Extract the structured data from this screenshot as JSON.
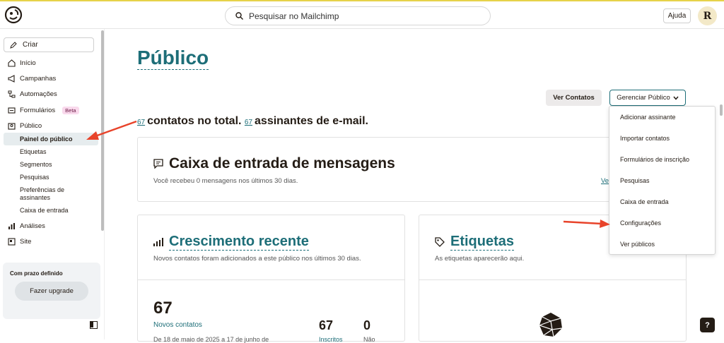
{
  "header": {
    "search_placeholder": "Pesquisar no Mailchimp",
    "help_label": "Ajuda",
    "avatar_initial": "R"
  },
  "sidebar": {
    "create_label": "Criar",
    "items": [
      {
        "label": "Início",
        "icon": "home-icon"
      },
      {
        "label": "Campanhas",
        "icon": "megaphone-icon"
      },
      {
        "label": "Automações",
        "icon": "automation-icon"
      },
      {
        "label": "Formulários",
        "icon": "form-icon",
        "badge": "Beta"
      },
      {
        "label": "Público",
        "icon": "audience-icon"
      }
    ],
    "sub_items": [
      {
        "label": "Painel do público",
        "active": true
      },
      {
        "label": "Etiquetas"
      },
      {
        "label": "Segmentos"
      },
      {
        "label": "Pesquisas"
      },
      {
        "label": "Preferências de assinantes"
      },
      {
        "label": "Caixa de entrada"
      }
    ],
    "bottom_items": [
      {
        "label": "Análises",
        "icon": "chart-icon"
      },
      {
        "label": "Site",
        "icon": "site-icon"
      }
    ],
    "trial": {
      "title": "Com prazo definido",
      "upgrade_label": "Fazer upgrade"
    }
  },
  "main": {
    "title": "Público",
    "view_contacts_label": "Ver Contatos",
    "manage_label": "Gerenciar Público",
    "totals": {
      "contacts_count": "67",
      "contacts_text": "contatos no total.",
      "subscribers_count": "67",
      "subscribers_text": "assinantes de e-mail."
    },
    "inbox_card": {
      "title": "Caixa de entrada de mensagens",
      "subtitle": "Você recebeu 0 mensagens nos últimos 30 dias.",
      "link": "Ve"
    },
    "growth_card": {
      "title": "Crescimento recente",
      "subtitle": "Novos contatos foram adicionados a este público nos últimos 30 dias.",
      "new_contacts_value": "67",
      "new_contacts_label": "Novos contatos",
      "subscribed_value": "67",
      "unsubscribed_value": "0",
      "date_range_partial": "De 18 de maio de 2025 a 17 de junho de",
      "subscribed_label_partial": "Inscritos",
      "unsubscribed_label_partial": "Não"
    },
    "tags_card": {
      "title": "Etiquetas",
      "subtitle": "As etiquetas aparecerão aqui."
    }
  },
  "dropdown": {
    "items": [
      "Adicionar assinante",
      "Importar contatos",
      "Formulários de inscrição",
      "Pesquisas",
      "Caixa de entrada",
      "Configurações",
      "Ver públicos"
    ]
  },
  "help_float_label": "?",
  "colors": {
    "accent": "#1d6e78",
    "annotation_arrow": "#e8432a",
    "beta_badge": "#f9d9ec"
  }
}
